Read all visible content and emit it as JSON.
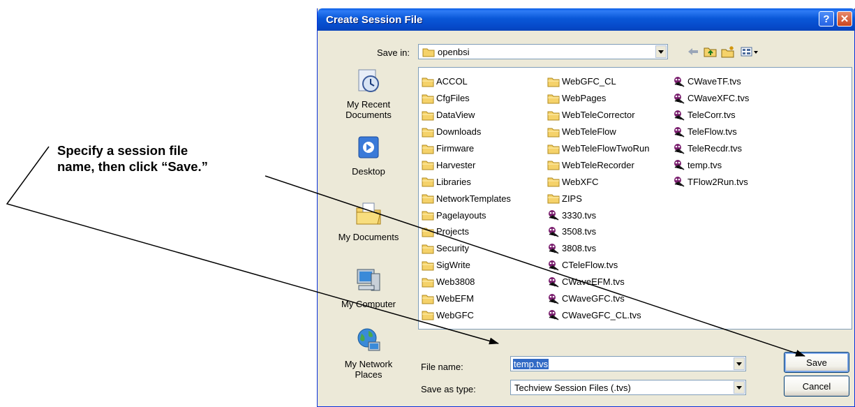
{
  "callout": {
    "line1": "Specify a session file",
    "line2": "name, then click “Save.”"
  },
  "dialog": {
    "title": "Create Session File",
    "help_icon": "help-icon",
    "close_icon": "close-icon",
    "save_in_label": "Save in:",
    "save_in_value": "openbsi",
    "places": [
      {
        "label_lines": [
          "My Recent",
          "Documents"
        ],
        "icon": "recent-documents-icon"
      },
      {
        "label_lines": [
          "Desktop"
        ],
        "icon": "desktop-icon"
      },
      {
        "label_lines": [
          "My Documents"
        ],
        "icon": "my-documents-icon"
      },
      {
        "label_lines": [
          "My Computer"
        ],
        "icon": "my-computer-icon"
      },
      {
        "label_lines": [
          "My Network",
          "Places"
        ],
        "icon": "network-places-icon"
      }
    ],
    "files": {
      "col1": [
        "ACCOL",
        "CfgFiles",
        "DataView",
        "Downloads",
        "Firmware",
        "Harvester",
        "Libraries",
        "NetworkTemplates",
        "Pagelayouts",
        "Projects",
        "Security",
        "SigWrite",
        "Web3808",
        "WebEFM",
        "WebGFC"
      ],
      "col2_folders": [
        "WebGFC_CL",
        "WebPages",
        "WebTeleCorrector",
        "WebTeleFlow",
        "WebTeleFlowTwoRun",
        "WebTeleRecorder",
        "WebXFC",
        "ZIPS"
      ],
      "col2_files": [
        "3330.tvs",
        "3508.tvs",
        "3808.tvs",
        "CTeleFlow.tvs",
        "CWaveEFM.tvs",
        "CWaveGFC.tvs",
        "CWaveGFC_CL.tvs"
      ],
      "col3_files": [
        "CWaveTF.tvs",
        "CWaveXFC.tvs",
        "TeleCorr.tvs",
        "TeleFlow.tvs",
        "TeleRecdr.tvs",
        "temp.tvs",
        "TFlow2Run.tvs"
      ]
    },
    "file_name_label": "File name:",
    "file_name_value": "temp.tvs",
    "save_type_label": "Save as type:",
    "save_type_value": "Techview Session Files (.tvs)",
    "save_button": "Save",
    "cancel_button": "Cancel"
  }
}
